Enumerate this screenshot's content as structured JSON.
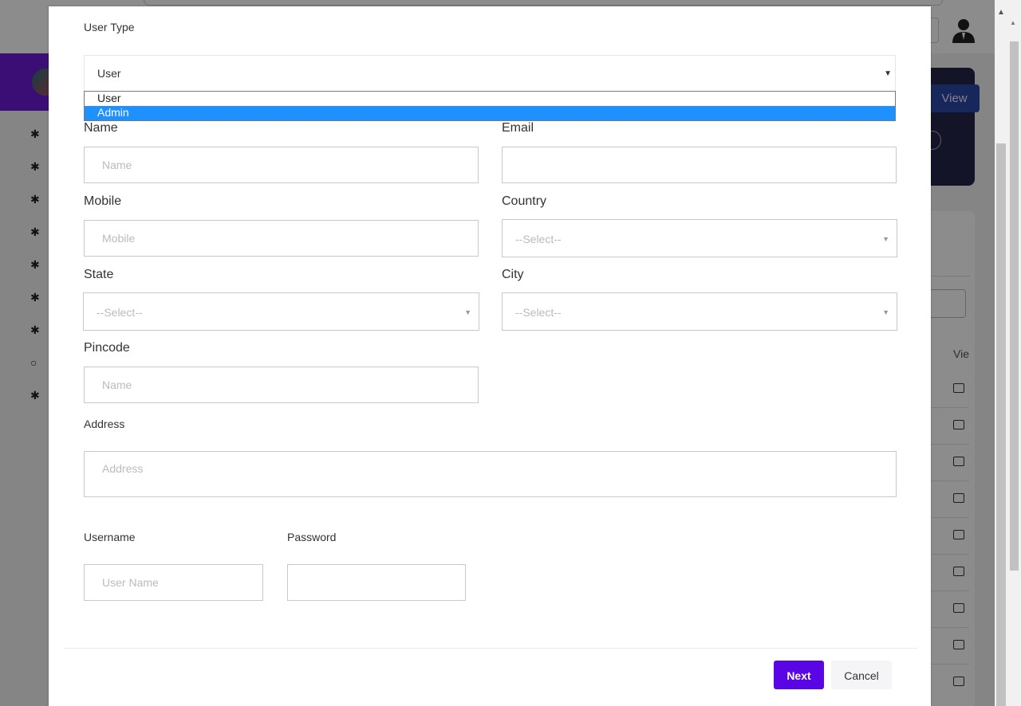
{
  "background": {
    "view_label": "View",
    "column_label": "Vie"
  },
  "form": {
    "user_type": {
      "label": "User Type",
      "selected": "User",
      "options": [
        "User",
        "Admin"
      ],
      "highlighted_option": "Admin"
    },
    "name": {
      "label": "Name",
      "placeholder": "Name",
      "value": ""
    },
    "email": {
      "label": "Email",
      "placeholder": "",
      "value": ""
    },
    "mobile": {
      "label": "Mobile",
      "placeholder": "Mobile",
      "value": ""
    },
    "country": {
      "label": "Country",
      "selected": "--Select--"
    },
    "state": {
      "label": "State",
      "selected": "--Select--"
    },
    "city": {
      "label": "City",
      "selected": "--Select--"
    },
    "pincode": {
      "label": "Pincode",
      "placeholder": "Name",
      "value": ""
    },
    "address": {
      "label": "Address",
      "placeholder": "Address",
      "value": ""
    },
    "username": {
      "label": "Username",
      "placeholder": "User Name",
      "value": ""
    },
    "password": {
      "label": "Password",
      "placeholder": "",
      "value": ""
    }
  },
  "footer": {
    "next_label": "Next",
    "cancel_label": "Cancel"
  },
  "colors": {
    "primary": "#5a05e6",
    "dropdown_highlight": "#1e90ff",
    "sidebar_brand": "#6a1ad6"
  }
}
